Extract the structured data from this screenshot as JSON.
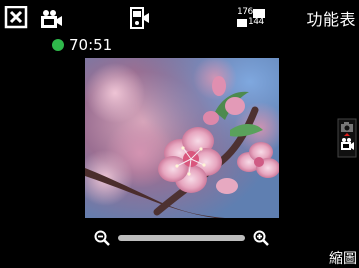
{
  "header": {
    "close_icon": "close-box-icon",
    "camera_icon": "video-camera-icon",
    "device_icon": "phone-camera-icon",
    "resolution": {
      "top": "176",
      "bottom": "144"
    },
    "menu_label": "功能表"
  },
  "recording": {
    "status_color": "#2fb84b",
    "time": "70:51"
  },
  "viewfinder": {
    "subject": "pink-blossom-branch"
  },
  "side_mode_switch": {
    "photo_icon": "photo-camera-icon",
    "video_icon": "video-camera-icon",
    "active": "video"
  },
  "zoom": {
    "out_icon": "zoom-out-icon",
    "in_icon": "zoom-in-icon",
    "level": 0
  },
  "footer": {
    "label": "縮圖"
  }
}
